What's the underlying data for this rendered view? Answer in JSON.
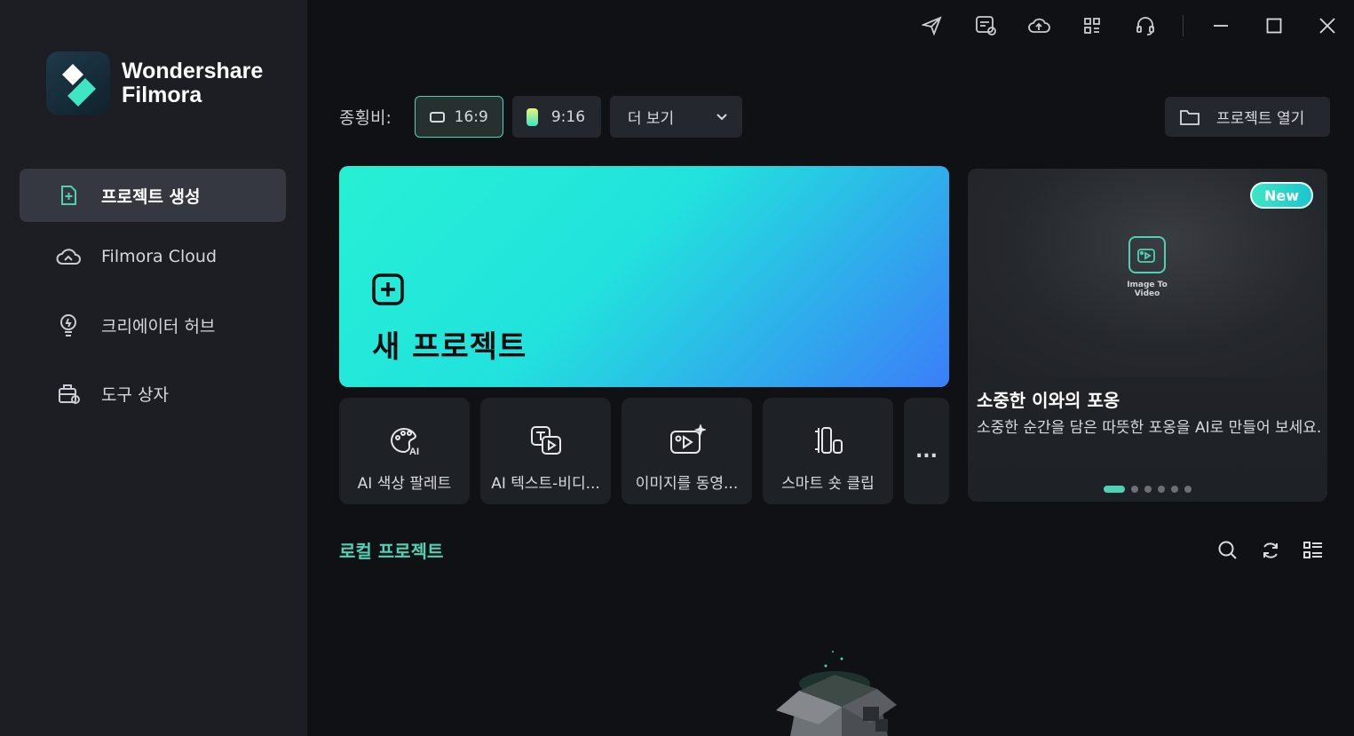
{
  "app": {
    "brand_line1": "Wondershare",
    "brand_line2": "Filmora",
    "accent": "#4fd1b3"
  },
  "sidebar": {
    "items": [
      {
        "label": "프로젝트 생성",
        "icon": "new-project-icon",
        "active": true
      },
      {
        "label": "Filmora Cloud",
        "icon": "cloud-icon",
        "active": false
      },
      {
        "label": "크리에이터 허브",
        "icon": "bulb-icon",
        "active": false
      },
      {
        "label": "도구 상자",
        "icon": "toolbox-icon",
        "active": false
      }
    ]
  },
  "titlebar": {
    "icons": [
      "send-icon",
      "feedback-icon",
      "cloud-upload-icon",
      "apps-grid-icon",
      "headset-icon",
      "minimize-icon",
      "maximize-icon",
      "close-icon"
    ]
  },
  "aspect": {
    "label": "종횡비:",
    "options": [
      "16:9",
      "9:16"
    ],
    "selected": "16:9",
    "more_label": "더 보기"
  },
  "open_project": {
    "label": "프로젝트 열기"
  },
  "new_project": {
    "label": "새 프로젝트"
  },
  "tools": [
    {
      "label": "AI 색상 팔레트",
      "icon": "ai-palette-icon"
    },
    {
      "label": "AI 텍스트-비디...",
      "icon": "text-to-video-icon"
    },
    {
      "label": "이미지를 동영...",
      "icon": "image-to-video-icon"
    },
    {
      "label": "스마트 숏 클립",
      "icon": "smart-short-clip-icon"
    }
  ],
  "tools_more": "...",
  "promo": {
    "badge": "New",
    "feature_caption": "Image To Video",
    "title": "소중한 이와의 포옹",
    "description": "소중한 순간을 담은 따뜻한 포옹을 AI로 만들어 보세요.",
    "slides": 6,
    "active_slide": 0
  },
  "local": {
    "title": "로컬 프로젝트",
    "actions": [
      "search-icon",
      "refresh-icon",
      "list-view-icon"
    ]
  }
}
